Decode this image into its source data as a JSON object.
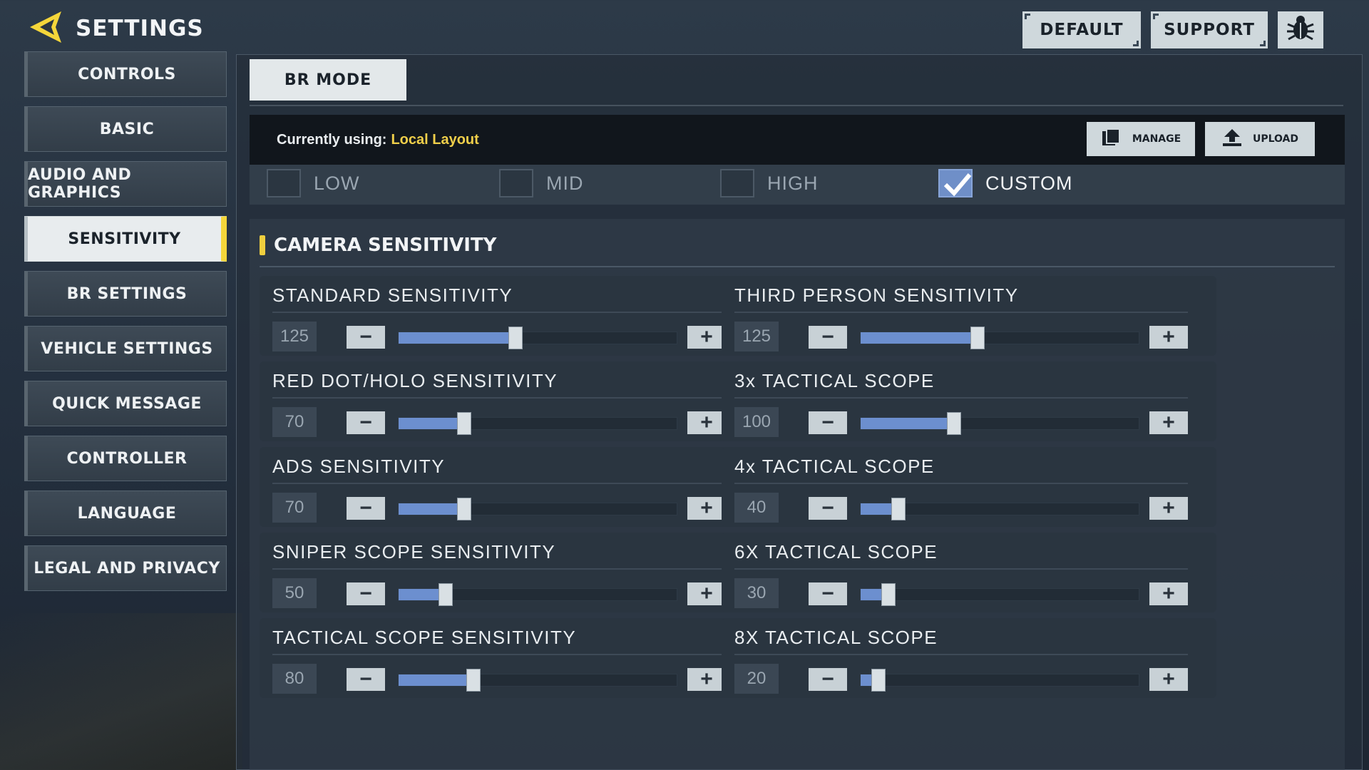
{
  "header": {
    "title": "SETTINGS",
    "back_icon": "back-arrow-icon",
    "accent": "#f5d63a"
  },
  "top_buttons": {
    "default_label": "DEFAULT",
    "support_label": "SUPPORT",
    "bug_icon": "bug-icon"
  },
  "sidebar": {
    "items": [
      {
        "label": "CONTROLS",
        "active": false
      },
      {
        "label": "BASIC",
        "active": false
      },
      {
        "label": "AUDIO AND GRAPHICS",
        "active": false
      },
      {
        "label": "SENSITIVITY",
        "active": true
      },
      {
        "label": "BR SETTINGS",
        "active": false
      },
      {
        "label": "VEHICLE SETTINGS",
        "active": false
      },
      {
        "label": "QUICK MESSAGE",
        "active": false
      },
      {
        "label": "CONTROLLER",
        "active": false
      },
      {
        "label": "LANGUAGE",
        "active": false
      },
      {
        "label": "LEGAL AND PRIVACY",
        "active": false
      }
    ]
  },
  "main": {
    "mode_tab": "BR MODE",
    "layout": {
      "label": "Currently using:",
      "value": "Local Layout",
      "value_color": "#f0cf4a"
    },
    "manage_label": "MANAGE",
    "upload_label": "UPLOAD",
    "presets": [
      {
        "label": "LOW",
        "checked": false
      },
      {
        "label": "MID",
        "checked": false
      },
      {
        "label": "HIGH",
        "checked": false
      },
      {
        "label": "CUSTOM",
        "checked": true
      }
    ],
    "section_title": "CAMERA SENSITIVITY",
    "sliders": [
      {
        "label": "STANDARD SENSITIVITY",
        "value": "125",
        "fraction": 0.42
      },
      {
        "label": "THIRD PERSON SENSITIVITY",
        "value": "125",
        "fraction": 0.42
      },
      {
        "label": "RED DOT/HOLO SENSITIVITY",
        "value": "70",
        "fraction": 0.235
      },
      {
        "label": "3x TACTICAL SCOPE",
        "value": "100",
        "fraction": 0.335
      },
      {
        "label": "ADS SENSITIVITY",
        "value": "70",
        "fraction": 0.235
      },
      {
        "label": "4x TACTICAL SCOPE",
        "value": "40",
        "fraction": 0.135
      },
      {
        "label": "SNIPER SCOPE SENSITIVITY",
        "value": "50",
        "fraction": 0.17
      },
      {
        "label": "6X TACTICAL SCOPE",
        "value": "30",
        "fraction": 0.1
      },
      {
        "label": "TACTICAL SCOPE SENSITIVITY",
        "value": "80",
        "fraction": 0.27
      },
      {
        "label": "8X TACTICAL SCOPE",
        "value": "20",
        "fraction": 0.065
      }
    ],
    "slider_fill_color": "#6c8fcf"
  }
}
